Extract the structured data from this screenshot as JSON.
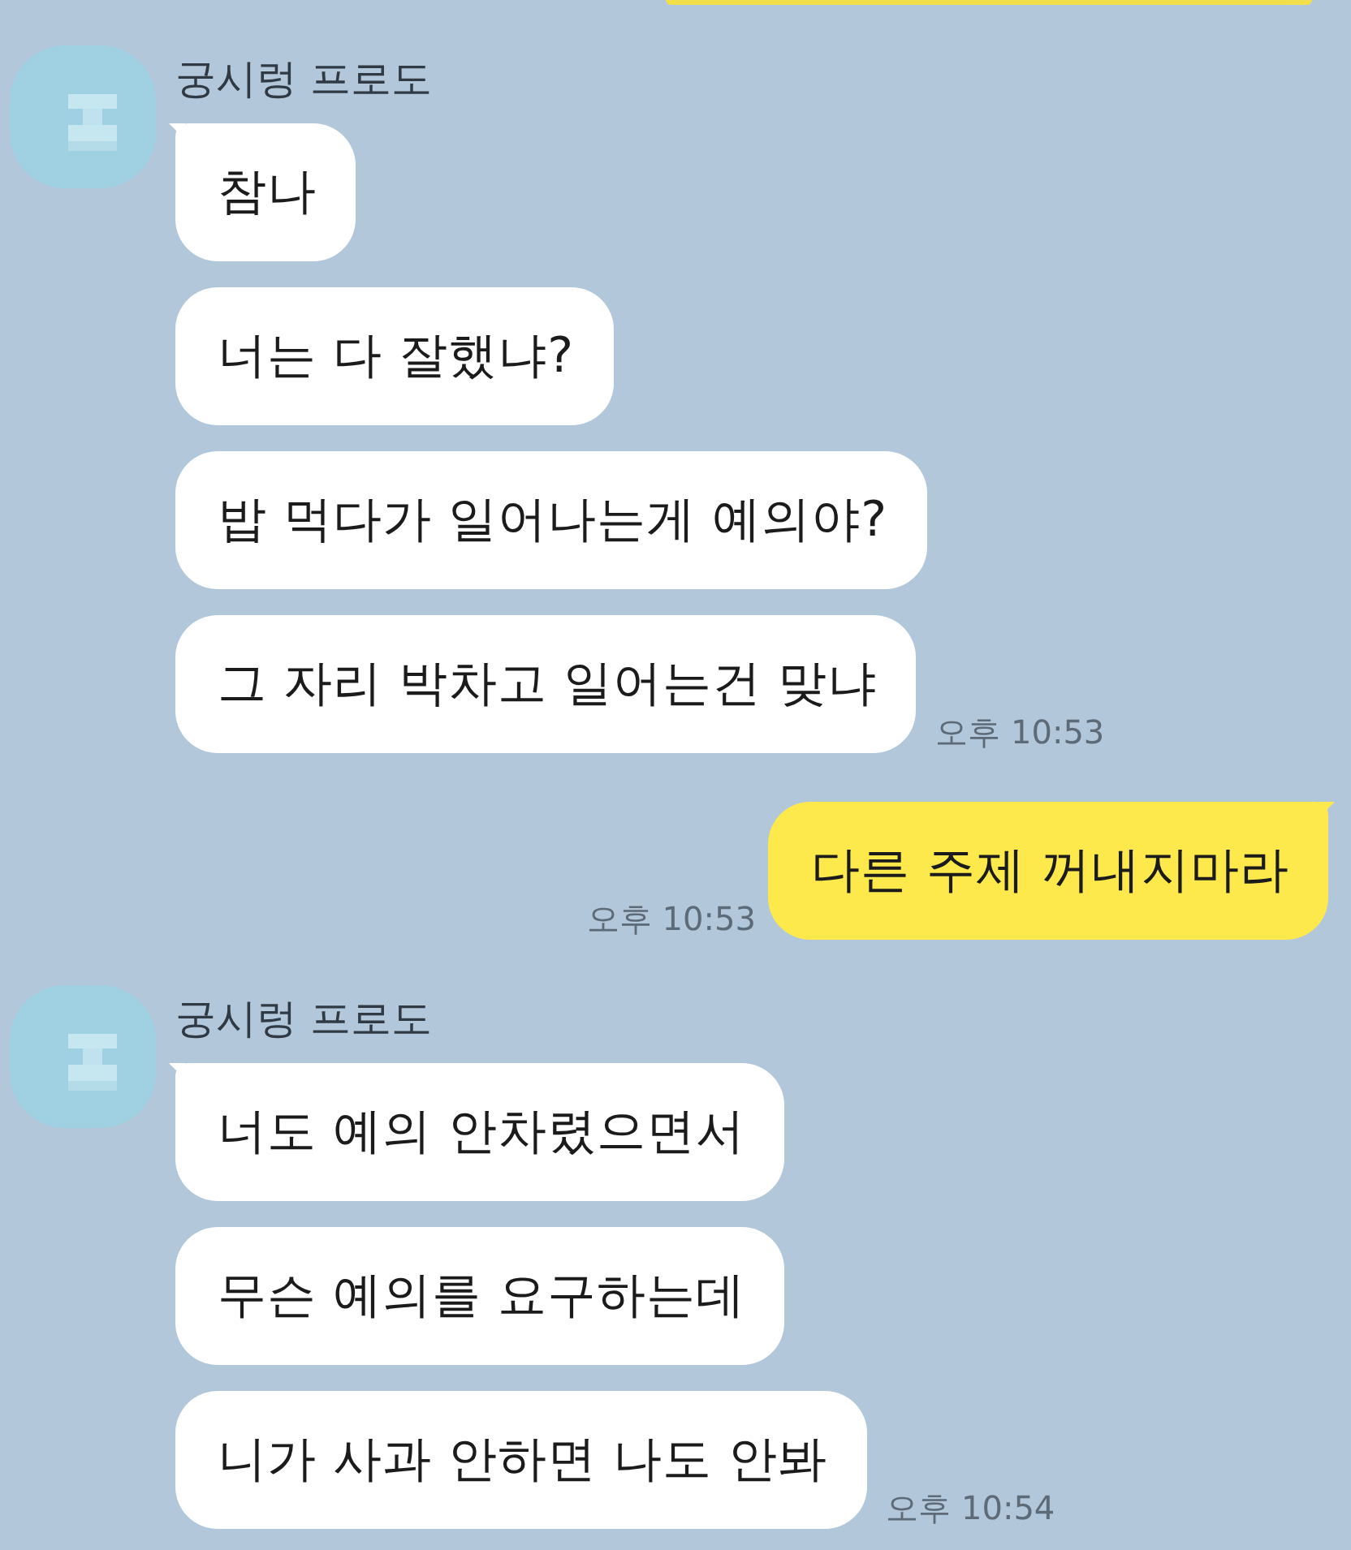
{
  "cut_off_bubble": {
    "kind": "sent"
  },
  "groups": [
    {
      "kind": "received",
      "sender": "궁시렁 프로도",
      "messages": [
        "참나",
        "너는 다 잘했냐?",
        "밥 먹다가 일어나는게 예의야?",
        "그 자리 박차고 일어는건 맞냐"
      ],
      "time": "오후 10:53"
    },
    {
      "kind": "sent",
      "messages": [
        "다른 주제 꺼내지마라"
      ],
      "time": "오후 10:53"
    },
    {
      "kind": "received",
      "sender": "궁시렁 프로도",
      "messages": [
        "너도 예의 안차렸으면서",
        "무슨 예의를 요구하는데",
        "니가 사과 안하면 나도 안봐"
      ],
      "time": "오후 10:54"
    }
  ]
}
